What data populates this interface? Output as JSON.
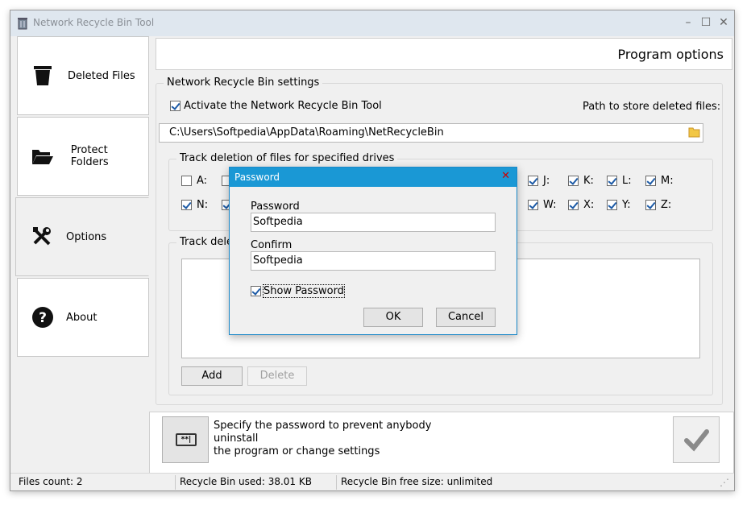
{
  "window": {
    "title": "Network Recycle Bin Tool"
  },
  "sidebar": {
    "items": [
      {
        "label": "Deleted Files"
      },
      {
        "label": "Protect Folders"
      },
      {
        "label": "Options"
      },
      {
        "label": "About"
      }
    ]
  },
  "header": {
    "title": "Program options"
  },
  "settings": {
    "legend": "Network Recycle Bin settings",
    "activate_label": "Activate the Network Recycle Bin Tool",
    "activate_checked": true,
    "path_label": "Path to store deleted files:",
    "path_value": "C:\\Users\\Softpedia\\AppData\\Roaming\\NetRecycleBin"
  },
  "drives": {
    "legend": "Track deletion of files for specified drives",
    "row1": [
      {
        "label": "A:",
        "checked": false
      },
      {
        "label": "J:",
        "checked": true
      },
      {
        "label": "K:",
        "checked": true
      },
      {
        "label": "L:",
        "checked": true
      },
      {
        "label": "M:",
        "checked": true
      }
    ],
    "row2": [
      {
        "label": "N:",
        "checked": true
      },
      {
        "label": "W:",
        "checked": true
      },
      {
        "label": "X:",
        "checked": true
      },
      {
        "label": "Y:",
        "checked": true
      },
      {
        "label": "Z:",
        "checked": true
      }
    ]
  },
  "folders": {
    "legend": "Track dele",
    "add_label": "Add",
    "delete_label": "Delete"
  },
  "bottom": {
    "hint_line1": "Specify the password to prevent anybody uninstall",
    "hint_line2": "the program or change settings"
  },
  "status": {
    "files_count": "Files count: 2",
    "used": "Recycle Bin used: 38.01 KB",
    "free": "Recycle Bin free size: unlimited"
  },
  "dialog": {
    "title": "Password",
    "password_label": "Password",
    "password_value": "Softpedia",
    "confirm_label": "Confirm",
    "confirm_value": "Softpedia",
    "show_password_label": "Show Password",
    "ok_label": "OK",
    "cancel_label": "Cancel"
  },
  "colors": {
    "accent": "#1a98d5",
    "titlebar": "#dfe7ef"
  }
}
